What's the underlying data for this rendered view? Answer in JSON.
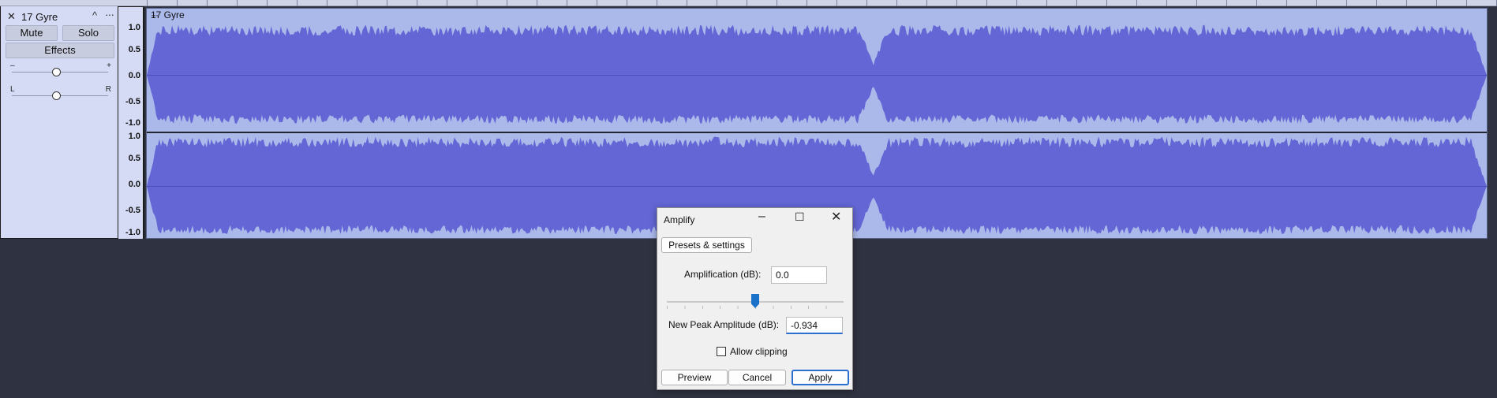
{
  "track": {
    "close_glyph": "✕",
    "name": "17 Gyre",
    "collapse_glyph": "^",
    "menu_glyph": "···",
    "mute_label": "Mute",
    "solo_label": "Solo",
    "effects_label": "Effects",
    "gain_minus": "–",
    "gain_plus": "+",
    "gain_level": 0.46,
    "pan_left": "L",
    "pan_right": "R",
    "pan_level": 0.46
  },
  "vertical_ruler": {
    "channel1": [
      "1.0",
      "0.5",
      "0.0",
      "-0.5",
      "-1.0"
    ],
    "channel2": [
      "1.0",
      "0.5",
      "0.0",
      "-0.5",
      "-1.0"
    ]
  },
  "clip": {
    "title": "17 Gyre",
    "menu_glyph": "···",
    "wave_color": "#6366d4",
    "background_color": "#aab8ea"
  },
  "dialog": {
    "title": "Amplify",
    "presets_label": "Presets & settings",
    "amplification_label": "Amplification (dB):",
    "amplification_value": "0.0",
    "slider_level": 0.5,
    "peak_label": "New Peak Amplitude (dB):",
    "peak_value": "-0.934",
    "allow_clipping_label": "Allow clipping",
    "allow_clipping_checked": false,
    "preview_label": "Preview",
    "cancel_label": "Cancel",
    "apply_label": "Apply",
    "accent_color": "#2b6fd1"
  },
  "colors": {
    "app_background": "#2f3240",
    "track_panel": "#d5dbf5"
  }
}
